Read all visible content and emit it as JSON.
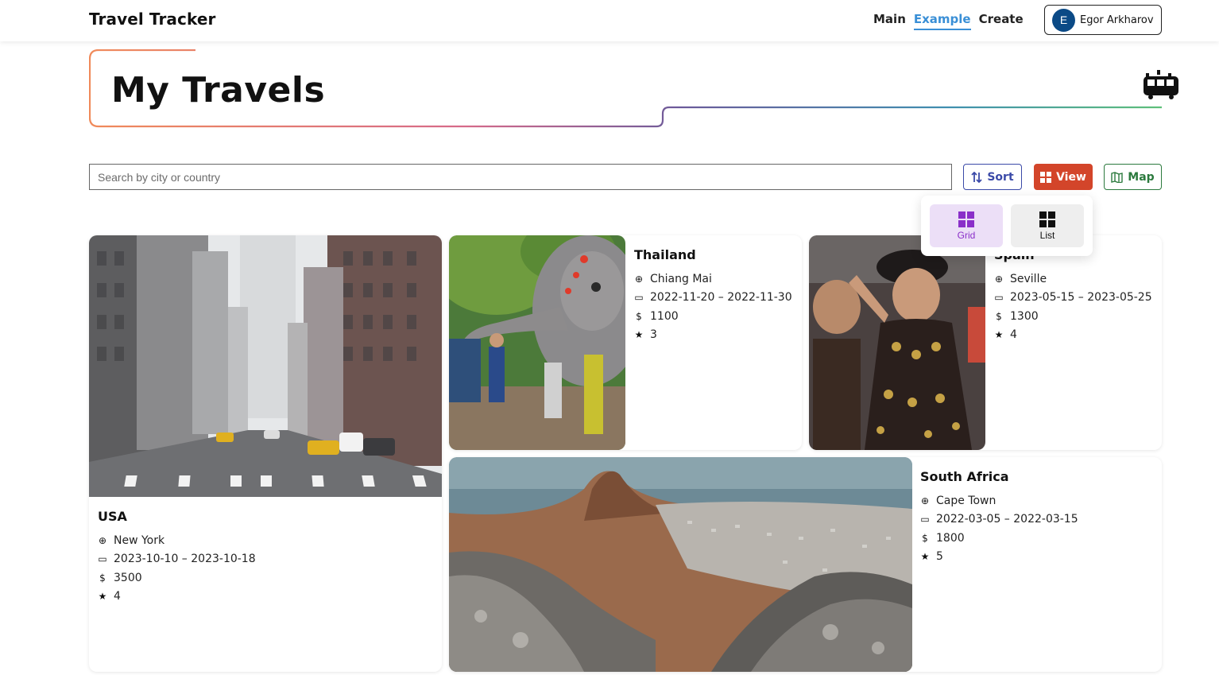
{
  "app": {
    "brand": "Travel Tracker"
  },
  "nav": {
    "items": [
      "Main",
      "Example",
      "Create"
    ],
    "active": "Example"
  },
  "user": {
    "initial": "E",
    "name": "Egor Arkharov"
  },
  "page": {
    "title": "My Travels"
  },
  "toolbar": {
    "search_placeholder": "Search by city or country",
    "sort_label": "Sort",
    "view_label": "View",
    "map_label": "Map"
  },
  "view_menu": {
    "grid_label": "Grid",
    "list_label": "List",
    "selected": "Grid"
  },
  "colors": {
    "accent_blue": "#3a8fd6",
    "sort": "#3b4aa8",
    "view": "#d3452a",
    "map": "#2c7a3e",
    "grid_selected": "#8a2fc9"
  },
  "trips": [
    {
      "country": "USA",
      "city": "New York",
      "dates": "2023-10-10 – 2023-10-18",
      "cost": "3500",
      "rating": "4",
      "photo": "city street"
    },
    {
      "country": "Thailand",
      "city": "Chiang Mai",
      "dates": "2022-11-20 – 2022-11-30",
      "cost": "1100",
      "rating": "3",
      "photo": "elephant"
    },
    {
      "country": "Spain",
      "city": "Seville",
      "dates": "2023-05-15 – 2023-05-25",
      "cost": "1300",
      "rating": "4",
      "photo": "dancer"
    },
    {
      "country": "South Africa",
      "city": "Cape Town",
      "dates": "2022-03-05 – 2022-03-15",
      "cost": "1800",
      "rating": "5",
      "photo": "mountain"
    }
  ]
}
